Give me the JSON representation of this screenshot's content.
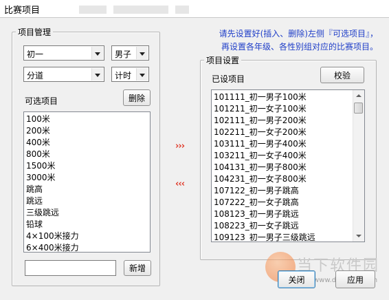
{
  "window": {
    "title": "比赛项目"
  },
  "project_management": {
    "legend": "项目管理",
    "grade_select": "初一",
    "gender_select": "男子",
    "type_select": "分道",
    "scoring_select": "计时",
    "available_label": "可选项目",
    "delete_button": "删除",
    "available_items": [
      "100米",
      "200米",
      "400米",
      "800米",
      "1500米",
      "3000米",
      "跳高",
      "跳远",
      "三级跳远",
      "铅球",
      "4×100米接力",
      "6×400米接力"
    ],
    "new_input_value": "",
    "add_button": "新增"
  },
  "transfer": {
    "add_arrows": "›››",
    "remove_arrows": "‹‹‹"
  },
  "hint_text": {
    "line1": "请先设置好(插入、删除)左侧『可选项目』，",
    "line2": "再设置各年级、各性别组对应的比赛项目。"
  },
  "project_settings": {
    "legend": "项目设置",
    "set_label": "已设项目",
    "verify_button": "校验",
    "set_items": [
      "101111_初一男子100米",
      "101211_初一女子100米",
      "102111_初一男子200米",
      "102211_初一女子200米",
      "103111_初一男子400米",
      "103211_初一女子400米",
      "104131_初一男子800米",
      "104231_初一女子800米",
      "107122_初一男子跳高",
      "107222_初一女子跳高",
      "108123_初一男子跳远",
      "108223_初一女子跳远",
      "109123_初一男子三级跳远"
    ]
  },
  "footer": {
    "close_button": "关闭",
    "apply_button": "应用"
  },
  "watermark": {
    "title": "当下软件园",
    "url": "www.downxia.com"
  },
  "colors": {
    "hint": "#1f3ec8",
    "arrows": "#e03a2a"
  }
}
